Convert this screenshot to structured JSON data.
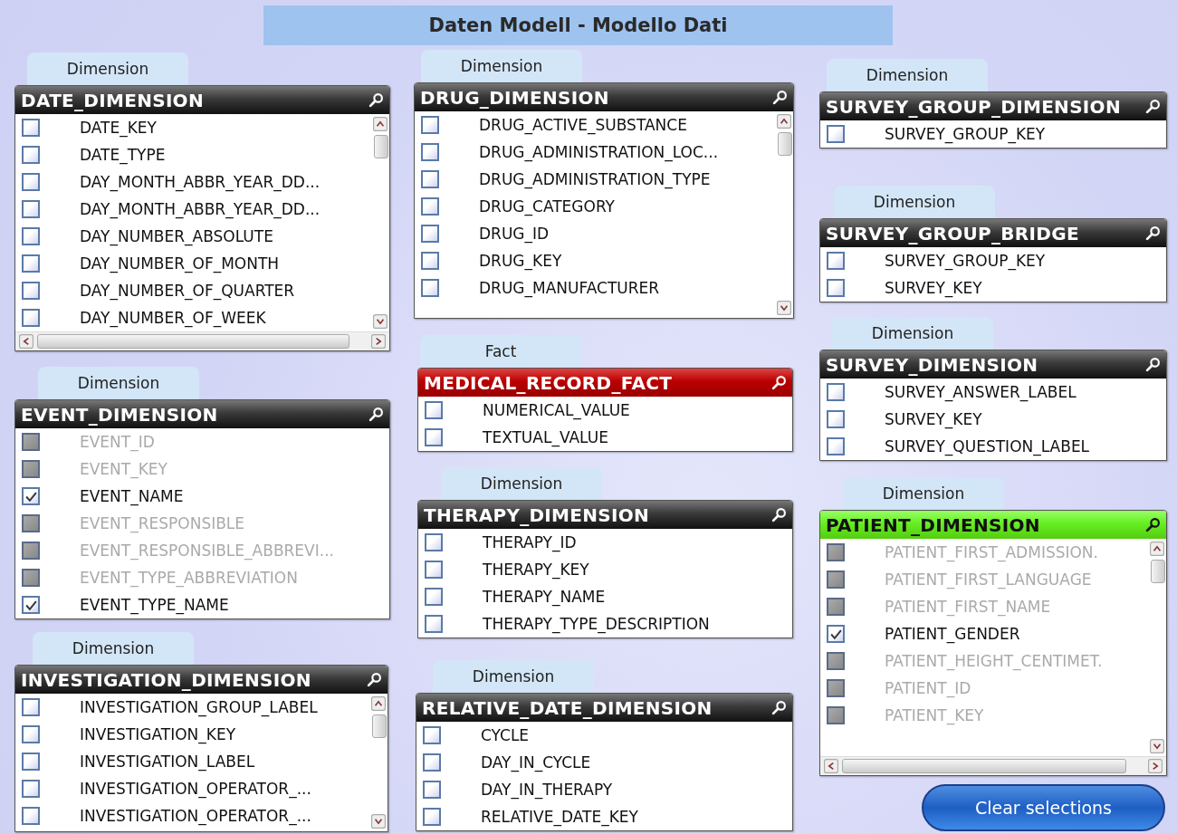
{
  "title": "Daten Modell - Modello Dati",
  "tables": [
    {
      "kind": "dimension",
      "tab": "Dimension",
      "name": "DATE_DIMENSION",
      "selected": false,
      "fields": [
        {
          "label": "DATE_KEY",
          "checked": false,
          "disabled": false
        },
        {
          "label": "DATE_TYPE",
          "checked": false,
          "disabled": false
        },
        {
          "label": "DAY_MONTH_ABBR_YEAR_DD...",
          "checked": false,
          "disabled": false
        },
        {
          "label": "DAY_MONTH_ABBR_YEAR_DD...",
          "checked": false,
          "disabled": false
        },
        {
          "label": "DAY_NUMBER_ABSOLUTE",
          "checked": false,
          "disabled": false
        },
        {
          "label": "DAY_NUMBER_OF_MONTH",
          "checked": false,
          "disabled": false
        },
        {
          "label": "DAY_NUMBER_OF_QUARTER",
          "checked": false,
          "disabled": false
        },
        {
          "label": "DAY_NUMBER_OF_WEEK",
          "checked": false,
          "disabled": false
        }
      ]
    },
    {
      "kind": "dimension",
      "tab": "Dimension",
      "name": "EVENT_DIMENSION",
      "selected": false,
      "fields": [
        {
          "label": "EVENT_ID",
          "checked": false,
          "disabled": true
        },
        {
          "label": "EVENT_KEY",
          "checked": false,
          "disabled": true
        },
        {
          "label": "EVENT_NAME",
          "checked": true,
          "disabled": false
        },
        {
          "label": "EVENT_RESPONSIBLE",
          "checked": false,
          "disabled": true
        },
        {
          "label": "EVENT_RESPONSIBLE_ABBREVI...",
          "checked": false,
          "disabled": true
        },
        {
          "label": "EVENT_TYPE_ABBREVIATION",
          "checked": false,
          "disabled": true
        },
        {
          "label": "EVENT_TYPE_NAME",
          "checked": true,
          "disabled": false
        }
      ]
    },
    {
      "kind": "dimension",
      "tab": "Dimension",
      "name": "INVESTIGATION_DIMENSION",
      "selected": false,
      "fields": [
        {
          "label": "INVESTIGATION_GROUP_LABEL",
          "checked": false,
          "disabled": false
        },
        {
          "label": "INVESTIGATION_KEY",
          "checked": false,
          "disabled": false
        },
        {
          "label": "INVESTIGATION_LABEL",
          "checked": false,
          "disabled": false
        },
        {
          "label": "INVESTIGATION_OPERATOR_...",
          "checked": false,
          "disabled": false
        },
        {
          "label": "INVESTIGATION_OPERATOR_...",
          "checked": false,
          "disabled": false
        }
      ]
    },
    {
      "kind": "dimension",
      "tab": "Dimension",
      "name": "DRUG_DIMENSION",
      "selected": false,
      "fields": [
        {
          "label": "DRUG_ACTIVE_SUBSTANCE",
          "checked": false,
          "disabled": false
        },
        {
          "label": "DRUG_ADMINISTRATION_LOC...",
          "checked": false,
          "disabled": false
        },
        {
          "label": "DRUG_ADMINISTRATION_TYPE",
          "checked": false,
          "disabled": false
        },
        {
          "label": "DRUG_CATEGORY",
          "checked": false,
          "disabled": false
        },
        {
          "label": "DRUG_ID",
          "checked": false,
          "disabled": false
        },
        {
          "label": "DRUG_KEY",
          "checked": false,
          "disabled": false
        },
        {
          "label": "DRUG_MANUFACTURER",
          "checked": false,
          "disabled": false
        }
      ]
    },
    {
      "kind": "fact",
      "tab": "Fact",
      "name": "MEDICAL_RECORD_FACT",
      "selected": false,
      "fields": [
        {
          "label": "NUMERICAL_VALUE",
          "checked": false,
          "disabled": false
        },
        {
          "label": "TEXTUAL_VALUE",
          "checked": false,
          "disabled": false
        }
      ]
    },
    {
      "kind": "dimension",
      "tab": "Dimension",
      "name": "THERAPY_DIMENSION",
      "selected": false,
      "fields": [
        {
          "label": "THERAPY_ID",
          "checked": false,
          "disabled": false
        },
        {
          "label": "THERAPY_KEY",
          "checked": false,
          "disabled": false
        },
        {
          "label": "THERAPY_NAME",
          "checked": false,
          "disabled": false
        },
        {
          "label": "THERAPY_TYPE_DESCRIPTION",
          "checked": false,
          "disabled": false
        }
      ]
    },
    {
      "kind": "dimension",
      "tab": "Dimension",
      "name": "RELATIVE_DATE_DIMENSION",
      "selected": false,
      "fields": [
        {
          "label": "CYCLE",
          "checked": false,
          "disabled": false
        },
        {
          "label": "DAY_IN_CYCLE",
          "checked": false,
          "disabled": false
        },
        {
          "label": "DAY_IN_THERAPY",
          "checked": false,
          "disabled": false
        },
        {
          "label": "RELATIVE_DATE_KEY",
          "checked": false,
          "disabled": false
        }
      ]
    },
    {
      "kind": "dimension",
      "tab": "Dimension",
      "name": "SURVEY_GROUP_DIMENSION",
      "selected": false,
      "fields": [
        {
          "label": "SURVEY_GROUP_KEY",
          "checked": false,
          "disabled": false
        }
      ]
    },
    {
      "kind": "dimension",
      "tab": "Dimension",
      "name": "SURVEY_GROUP_BRIDGE",
      "selected": false,
      "fields": [
        {
          "label": "SURVEY_GROUP_KEY",
          "checked": false,
          "disabled": false
        },
        {
          "label": "SURVEY_KEY",
          "checked": false,
          "disabled": false
        }
      ]
    },
    {
      "kind": "dimension",
      "tab": "Dimension",
      "name": "SURVEY_DIMENSION",
      "selected": false,
      "fields": [
        {
          "label": "SURVEY_ANSWER_LABEL",
          "checked": false,
          "disabled": false
        },
        {
          "label": "SURVEY_KEY",
          "checked": false,
          "disabled": false
        },
        {
          "label": "SURVEY_QUESTION_LABEL",
          "checked": false,
          "disabled": false
        }
      ]
    },
    {
      "kind": "dimension",
      "tab": "Dimension",
      "name": "PATIENT_DIMENSION",
      "selected": true,
      "fields": [
        {
          "label": "PATIENT_FIRST_ADMISSION.",
          "checked": false,
          "disabled": true
        },
        {
          "label": "PATIENT_FIRST_LANGUAGE",
          "checked": false,
          "disabled": true
        },
        {
          "label": "PATIENT_FIRST_NAME",
          "checked": false,
          "disabled": true
        },
        {
          "label": "PATIENT_GENDER",
          "checked": true,
          "disabled": false
        },
        {
          "label": "PATIENT_HEIGHT_CENTIMET.",
          "checked": false,
          "disabled": true
        },
        {
          "label": "PATIENT_ID",
          "checked": false,
          "disabled": true
        },
        {
          "label": "PATIENT_KEY",
          "checked": false,
          "disabled": true
        }
      ]
    }
  ],
  "clear_button": "Clear selections"
}
